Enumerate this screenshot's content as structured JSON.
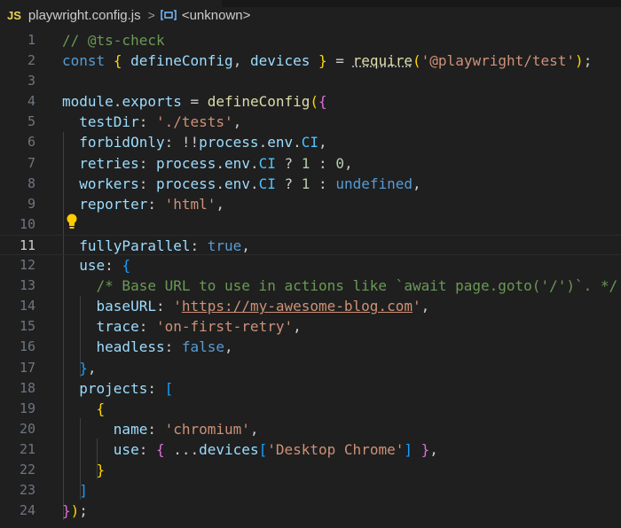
{
  "breadcrumb": {
    "lang_badge": "JS",
    "file": "playwright.config.js",
    "separator": ">",
    "symbol": "<unknown>"
  },
  "colors": {
    "background": "#1f1f1f",
    "comment": "#6a9955",
    "keyword": "#569cd6",
    "string": "#ce9178",
    "lightbulb": "#ffcc00"
  },
  "editor": {
    "current_line": 11,
    "lines": [
      {
        "n": "1",
        "tokens": [
          {
            "t": "// @ts-check",
            "c": "c-com"
          }
        ]
      },
      {
        "n": "2",
        "tokens": [
          {
            "t": "const",
            "c": "c-key"
          },
          {
            "t": " ",
            "c": ""
          },
          {
            "t": "{",
            "c": "c-br1"
          },
          {
            "t": " defineConfig",
            "c": "c-var"
          },
          {
            "t": ", ",
            "c": "c-punc"
          },
          {
            "t": "devices",
            "c": "c-var"
          },
          {
            "t": " ",
            "c": ""
          },
          {
            "t": "}",
            "c": "c-br1"
          },
          {
            "t": " = ",
            "c": "c-punc"
          },
          {
            "t": "require",
            "c": "c-fn sq-dots"
          },
          {
            "t": "(",
            "c": "c-br1"
          },
          {
            "t": "'@playwright/test'",
            "c": "c-str"
          },
          {
            "t": ")",
            "c": "c-br1"
          },
          {
            "t": ";",
            "c": "c-punc"
          }
        ]
      },
      {
        "n": "3",
        "tokens": []
      },
      {
        "n": "4",
        "tokens": [
          {
            "t": "module",
            "c": "c-var"
          },
          {
            "t": ".",
            "c": "c-punc"
          },
          {
            "t": "exports",
            "c": "c-var"
          },
          {
            "t": " = ",
            "c": "c-punc"
          },
          {
            "t": "defineConfig",
            "c": "c-fn"
          },
          {
            "t": "(",
            "c": "c-br1"
          },
          {
            "t": "{",
            "c": "c-br2"
          }
        ]
      },
      {
        "n": "5",
        "tokens": [
          {
            "t": "  testDir",
            "c": "c-var"
          },
          {
            "t": ": ",
            "c": "c-punc"
          },
          {
            "t": "'./tests'",
            "c": "c-str"
          },
          {
            "t": ",",
            "c": "c-punc"
          }
        ]
      },
      {
        "n": "6",
        "tokens": [
          {
            "t": "  forbidOnly",
            "c": "c-var"
          },
          {
            "t": ": !!",
            "c": "c-punc"
          },
          {
            "t": "process",
            "c": "c-var"
          },
          {
            "t": ".",
            "c": "c-punc"
          },
          {
            "t": "env",
            "c": "c-var"
          },
          {
            "t": ".",
            "c": "c-punc"
          },
          {
            "t": "CI",
            "c": "c-const"
          },
          {
            "t": ",",
            "c": "c-punc"
          }
        ]
      },
      {
        "n": "7",
        "tokens": [
          {
            "t": "  retries",
            "c": "c-var"
          },
          {
            "t": ": ",
            "c": "c-punc"
          },
          {
            "t": "process",
            "c": "c-var"
          },
          {
            "t": ".",
            "c": "c-punc"
          },
          {
            "t": "env",
            "c": "c-var"
          },
          {
            "t": ".",
            "c": "c-punc"
          },
          {
            "t": "CI",
            "c": "c-const"
          },
          {
            "t": " ? ",
            "c": "c-punc"
          },
          {
            "t": "1",
            "c": "c-num"
          },
          {
            "t": " : ",
            "c": "c-punc"
          },
          {
            "t": "0",
            "c": "c-num"
          },
          {
            "t": ",",
            "c": "c-punc"
          }
        ]
      },
      {
        "n": "8",
        "tokens": [
          {
            "t": "  workers",
            "c": "c-var"
          },
          {
            "t": ": ",
            "c": "c-punc"
          },
          {
            "t": "process",
            "c": "c-var"
          },
          {
            "t": ".",
            "c": "c-punc"
          },
          {
            "t": "env",
            "c": "c-var"
          },
          {
            "t": ".",
            "c": "c-punc"
          },
          {
            "t": "CI",
            "c": "c-const"
          },
          {
            "t": " ? ",
            "c": "c-punc"
          },
          {
            "t": "1",
            "c": "c-num"
          },
          {
            "t": " : ",
            "c": "c-punc"
          },
          {
            "t": "undefined",
            "c": "c-key"
          },
          {
            "t": ",",
            "c": "c-punc"
          }
        ]
      },
      {
        "n": "9",
        "tokens": [
          {
            "t": "  reporter",
            "c": "c-var"
          },
          {
            "t": ": ",
            "c": "c-punc"
          },
          {
            "t": "'html'",
            "c": "c-str"
          },
          {
            "t": ",",
            "c": "c-punc"
          }
        ]
      },
      {
        "n": "10",
        "tokens": []
      },
      {
        "n": "11",
        "tokens": [
          {
            "t": "  fullyParallel",
            "c": "c-var"
          },
          {
            "t": ": ",
            "c": "c-punc"
          },
          {
            "t": "true",
            "c": "c-key"
          },
          {
            "t": ",",
            "c": "c-punc"
          }
        ]
      },
      {
        "n": "12",
        "tokens": [
          {
            "t": "  use",
            "c": "c-var"
          },
          {
            "t": ": ",
            "c": "c-punc"
          },
          {
            "t": "{",
            "c": "c-br3"
          }
        ]
      },
      {
        "n": "13",
        "tokens": [
          {
            "t": "    /* Base URL to use in actions like `await page.goto('/')`. */",
            "c": "c-com"
          }
        ]
      },
      {
        "n": "14",
        "tokens": [
          {
            "t": "    baseURL",
            "c": "c-var"
          },
          {
            "t": ": ",
            "c": "c-punc"
          },
          {
            "t": "'",
            "c": "c-str"
          },
          {
            "t": "https://my-awesome-blog.com",
            "c": "c-str url-underline"
          },
          {
            "t": "'",
            "c": "c-str"
          },
          {
            "t": ",",
            "c": "c-punc"
          }
        ]
      },
      {
        "n": "15",
        "tokens": [
          {
            "t": "    trace",
            "c": "c-var"
          },
          {
            "t": ": ",
            "c": "c-punc"
          },
          {
            "t": "'on-first-retry'",
            "c": "c-str"
          },
          {
            "t": ",",
            "c": "c-punc"
          }
        ]
      },
      {
        "n": "16",
        "tokens": [
          {
            "t": "    headless",
            "c": "c-var"
          },
          {
            "t": ": ",
            "c": "c-punc"
          },
          {
            "t": "false",
            "c": "c-key"
          },
          {
            "t": ",",
            "c": "c-punc"
          }
        ]
      },
      {
        "n": "17",
        "tokens": [
          {
            "t": "  ",
            "c": ""
          },
          {
            "t": "}",
            "c": "c-br3"
          },
          {
            "t": ",",
            "c": "c-punc"
          }
        ]
      },
      {
        "n": "18",
        "tokens": [
          {
            "t": "  projects",
            "c": "c-var"
          },
          {
            "t": ": ",
            "c": "c-punc"
          },
          {
            "t": "[",
            "c": "c-br3"
          }
        ]
      },
      {
        "n": "19",
        "tokens": [
          {
            "t": "    ",
            "c": ""
          },
          {
            "t": "{",
            "c": "c-br1"
          }
        ]
      },
      {
        "n": "20",
        "tokens": [
          {
            "t": "      name",
            "c": "c-var"
          },
          {
            "t": ": ",
            "c": "c-punc"
          },
          {
            "t": "'chromium'",
            "c": "c-str"
          },
          {
            "t": ",",
            "c": "c-punc"
          }
        ]
      },
      {
        "n": "21",
        "tokens": [
          {
            "t": "      use",
            "c": "c-var"
          },
          {
            "t": ": ",
            "c": "c-punc"
          },
          {
            "t": "{",
            "c": "c-br2"
          },
          {
            "t": " ...",
            "c": "c-punc"
          },
          {
            "t": "devices",
            "c": "c-var"
          },
          {
            "t": "[",
            "c": "c-br3"
          },
          {
            "t": "'Desktop Chrome'",
            "c": "c-str"
          },
          {
            "t": "]",
            "c": "c-br3"
          },
          {
            "t": " ",
            "c": ""
          },
          {
            "t": "}",
            "c": "c-br2"
          },
          {
            "t": ",",
            "c": "c-punc"
          }
        ]
      },
      {
        "n": "22",
        "tokens": [
          {
            "t": "    ",
            "c": ""
          },
          {
            "t": "}",
            "c": "c-br1"
          }
        ]
      },
      {
        "n": "23",
        "tokens": [
          {
            "t": "  ",
            "c": ""
          },
          {
            "t": "]",
            "c": "c-br3"
          }
        ]
      },
      {
        "n": "24",
        "tokens": [
          {
            "t": "}",
            "c": "c-br2"
          },
          {
            "t": ")",
            "c": "c-br1"
          },
          {
            "t": ";",
            "c": "c-punc"
          }
        ]
      }
    ]
  }
}
